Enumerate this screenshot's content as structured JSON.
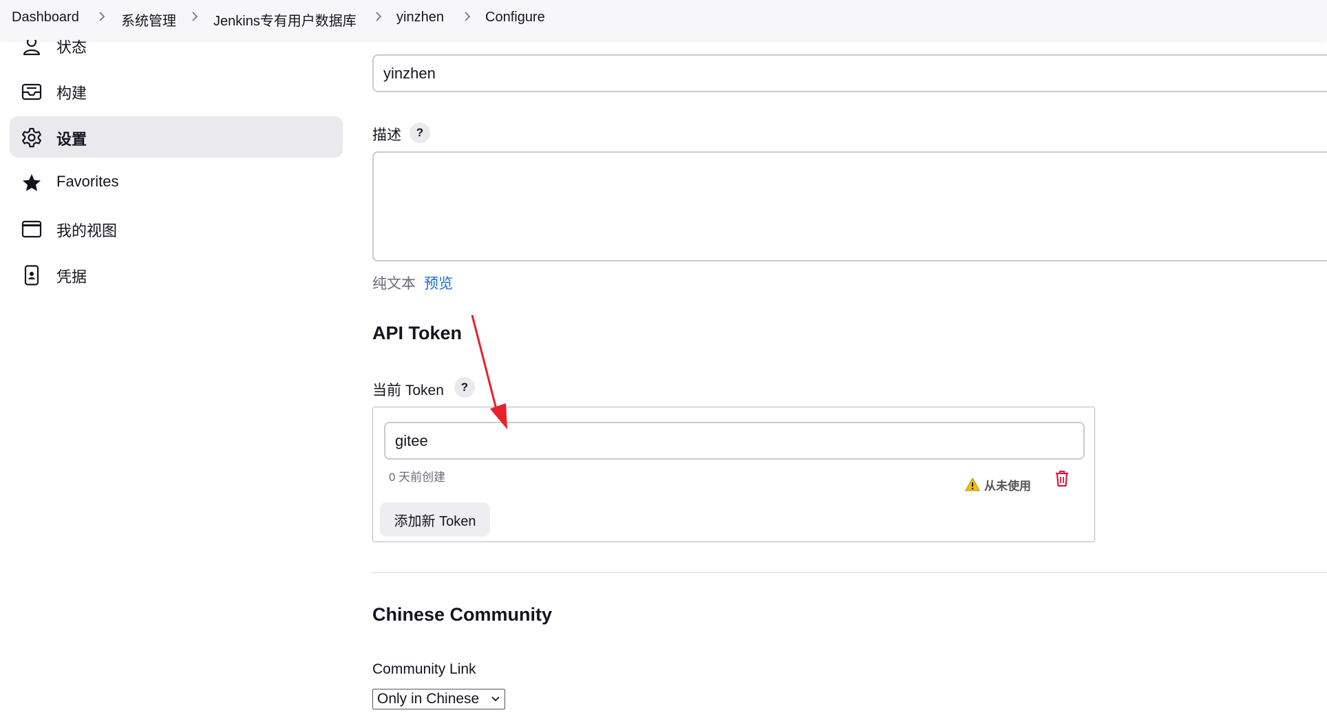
{
  "breadcrumb": {
    "items": [
      "Dashboard",
      "系统管理",
      "Jenkins专有用户数据库",
      "yinzhen",
      "Configure"
    ]
  },
  "sidebar": {
    "items": [
      {
        "label": "状态",
        "icon": "person-icon"
      },
      {
        "label": "构建",
        "icon": "inbox-icon"
      },
      {
        "label": "设置",
        "icon": "gear-icon",
        "active": true
      },
      {
        "label": "Favorites",
        "icon": "star-icon"
      },
      {
        "label": "我的视图",
        "icon": "window-icon"
      },
      {
        "label": "凭据",
        "icon": "phone-icon"
      }
    ]
  },
  "form": {
    "fullname_value": "yinzhen",
    "description_label": "描述",
    "help_mark": "?",
    "description_value": "",
    "plain_text_label": "纯文本",
    "preview_link": "预览"
  },
  "api_token": {
    "section_title": "API Token",
    "current_label": "当前 Token",
    "token_name": "gitee",
    "created_text": "0 天前创建",
    "usage_status": "从未使用",
    "add_button": "添加新 Token"
  },
  "community": {
    "section_title": "Chinese Community",
    "link_label": "Community Link",
    "link_selected": "Only in Chinese"
  },
  "colors": {
    "accent_link": "#1b6ad8",
    "delete_red": "#e0143c",
    "warning_yellow": "#f2c200",
    "annotation_arrow": "#e8202a"
  }
}
